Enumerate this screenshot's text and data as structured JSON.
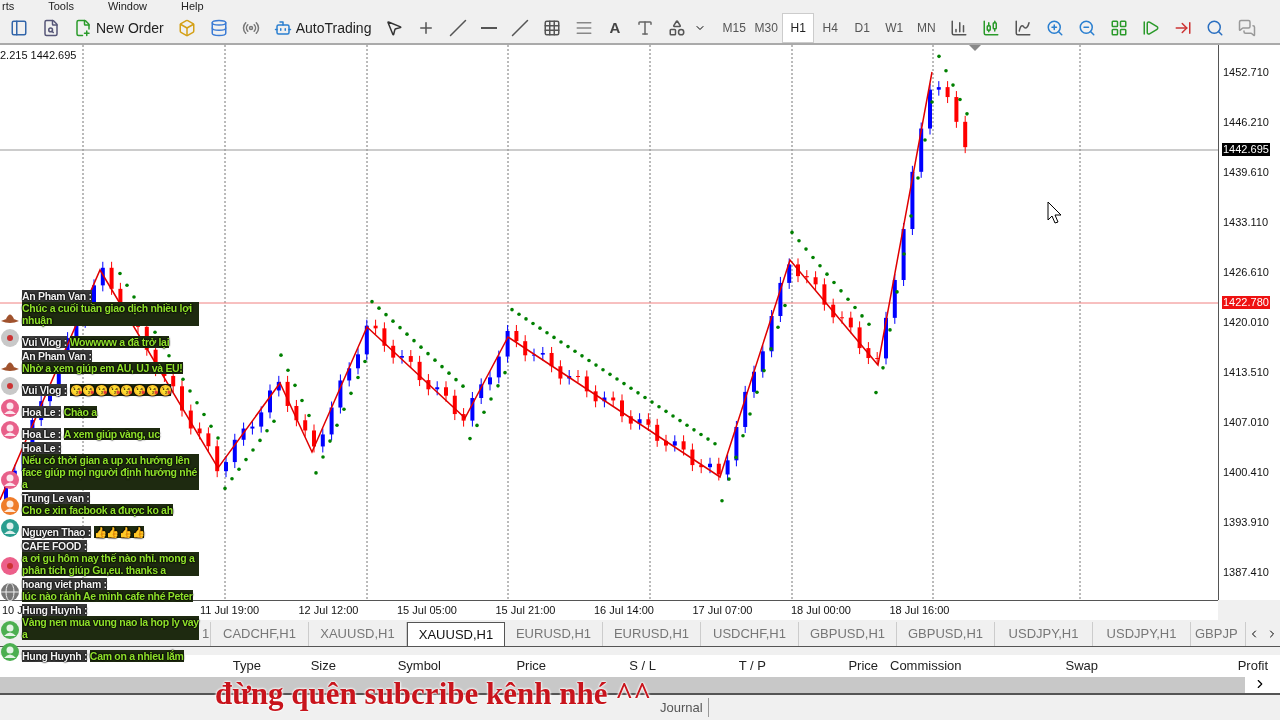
{
  "menu": [
    "rts",
    "Tools",
    "Window",
    "Help"
  ],
  "toolbar": {
    "new_order": "New Order",
    "auto_trading": "AutoTrading",
    "text_tool": "A",
    "timeframes": [
      {
        "label": "M15",
        "selected": false
      },
      {
        "label": "M30",
        "selected": false
      },
      {
        "label": "H1",
        "selected": true
      },
      {
        "label": "H4",
        "selected": false
      },
      {
        "label": "D1",
        "selected": false
      },
      {
        "label": "W1",
        "selected": false
      },
      {
        "label": "MN",
        "selected": false
      }
    ]
  },
  "chart": {
    "header": "2.215 1442.695",
    "price_labels": [
      {
        "label": "1452.710",
        "kind": "tick"
      },
      {
        "label": "1446.210",
        "kind": "tick"
      },
      {
        "label": "1442.695",
        "kind": "bid"
      },
      {
        "label": "1439.610",
        "kind": "tick"
      },
      {
        "label": "1433.110",
        "kind": "tick"
      },
      {
        "label": "1426.610",
        "kind": "tick"
      },
      {
        "label": "1422.780",
        "kind": "alert"
      },
      {
        "label": "1420.010",
        "kind": "tick"
      },
      {
        "label": "1413.510",
        "kind": "tick"
      },
      {
        "label": "1407.010",
        "kind": "tick"
      },
      {
        "label": "1400.410",
        "kind": "tick"
      },
      {
        "label": "1393.910",
        "kind": "tick"
      },
      {
        "label": "1387.410",
        "kind": "tick"
      }
    ],
    "time_labels": [
      "10 J",
      "11 Jul 19:00",
      "12 Jul 12:00",
      "15 Jul 05:00",
      "15 Jul 21:00",
      "16 Jul 14:00",
      "17 Jul 07:00",
      "18 Jul 00:00",
      "18 Jul 16:00"
    ]
  },
  "symbol_tabs": [
    {
      "label": "1",
      "selected": false
    },
    {
      "label": "CADCHF,H1",
      "selected": false
    },
    {
      "label": "XAUUSD,H1",
      "selected": false
    },
    {
      "label": "XAUUSD,H1",
      "selected": true
    },
    {
      "label": "EURUSD,H1",
      "selected": false
    },
    {
      "label": "EURUSD,H1",
      "selected": false
    },
    {
      "label": "USDCHF,H1",
      "selected": false
    },
    {
      "label": "GBPUSD,H1",
      "selected": false
    },
    {
      "label": "GBPUSD,H1",
      "selected": false
    },
    {
      "label": "USDJPY,H1",
      "selected": false
    },
    {
      "label": "USDJPY,H1",
      "selected": false
    },
    {
      "label": "GBPJP",
      "selected": false
    }
  ],
  "terminal": {
    "columns": [
      "Type",
      "Size",
      "Symbol",
      "Price",
      "S / L",
      "T / P",
      "Price",
      "Commission",
      "Swap",
      "Profit"
    ],
    "tabs": [
      "Journal"
    ]
  },
  "chat": [
    {
      "name": "An Pham Van :",
      "message": "Chúc a cuối tuần giao dịch nhiều lợi nhuận",
      "kind": "hat",
      "color": "#a0522d"
    },
    {
      "name": "Vui Vlog :",
      "message": "Wowwww a đã trở lại",
      "kind": "logo",
      "color": "#c8c8c8"
    },
    {
      "name": "An Pham Van :",
      "message": "Nhờ a xem giúp em AU, UJ và EU!",
      "kind": "hat",
      "color": "#a0522d"
    },
    {
      "name": "Vui Vlog :",
      "message": "😘😘😘😘😘😘😘😘",
      "kind": "logo",
      "color": "#c8c8c8"
    },
    {
      "name": "Hoa Le :",
      "message": "Chào a",
      "kind": "person",
      "color": "#e8608a"
    },
    {
      "name": "Hoa Le :",
      "message": "A xem giúp vàng, uc",
      "kind": "person",
      "color": "#e8608a"
    },
    {
      "name": "Hoa Le :",
      "message": "Nếu có thời gian a up xu hướng lên face giúp mọi người định hướng nhé a",
      "kind": "person",
      "color": "#e8608a"
    },
    {
      "name": "Trung Le van :",
      "message": "Cho e xin facbook a được ko ah",
      "kind": "person",
      "color": "#ef7c2a"
    },
    {
      "name": "Nguyen Thao :",
      "message": "👍👍👍👍",
      "kind": "person",
      "color": "#2a9d8f"
    },
    {
      "name": "CAFE FOOD :",
      "message": "a ơi gu hôm nay thế nào nhỉ. mong a phân tích giúp Gu,eu. thanks a",
      "kind": "logo",
      "color": "#ec5f8a"
    },
    {
      "name": "hoang viet pham :",
      "message": "lúc nào rảnh Ae mình cafe nhé Peter",
      "kind": "globe",
      "color": "#777777"
    },
    {
      "name": "Hung Huynh :",
      "message": "Vàng nen mua vung nao la hop ly vay a",
      "kind": "person",
      "color": "#4caf50"
    },
    {
      "name": "Hung Huynh :",
      "message": "Cam on a nhieu lắm",
      "kind": "person",
      "color": "#4caf50"
    }
  ],
  "caption": "đừng quên subcribe kênh nhé ^^"
}
